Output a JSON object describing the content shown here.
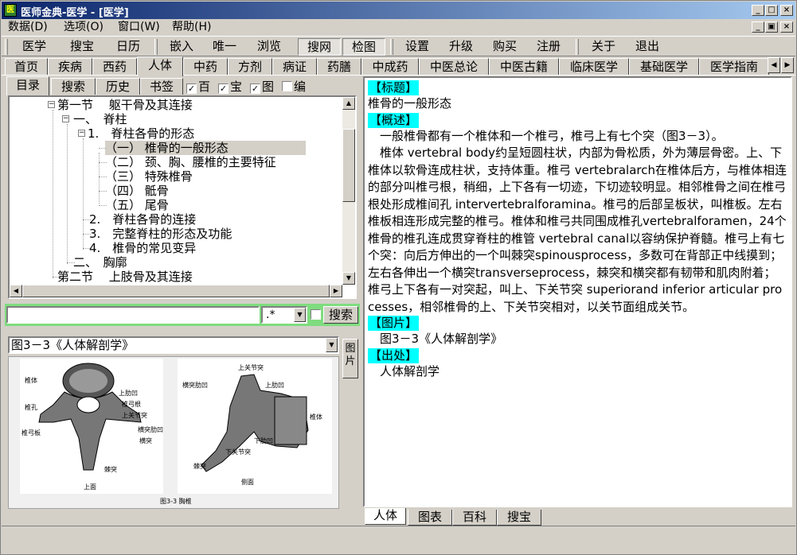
{
  "window": {
    "title": "医师金典-医学 - [医学]",
    "app_icon": "app-icon"
  },
  "menu": [
    "数据(D)",
    "选项(O)",
    "窗口(W)",
    "帮助(H)"
  ],
  "toolbar": {
    "group1": [
      "医学",
      "搜宝",
      "日历"
    ],
    "group2": [
      "嵌入",
      "唯一",
      "浏览"
    ],
    "group3": [
      "搜网",
      "检图"
    ],
    "group4": [
      "设置",
      "升级",
      "购买",
      "注册"
    ],
    "group5": [
      "关于",
      "退出"
    ]
  },
  "tabs": [
    "首页",
    "疾病",
    "西药",
    "人体",
    "中药",
    "方剂",
    "病证",
    "药膳",
    "中成药",
    "中医总论",
    "中医古籍",
    "临床医学",
    "基础医学",
    "医学指南"
  ],
  "active_tab": "人体",
  "left_tabs": [
    "目录",
    "搜索",
    "历史",
    "书签"
  ],
  "left_checks": [
    {
      "label": "百",
      "checked": true
    },
    {
      "label": "宝",
      "checked": true
    },
    {
      "label": "图",
      "checked": true
    },
    {
      "label": "编",
      "checked": false
    }
  ],
  "tree": [
    {
      "text": "第一节　 躯干骨及其连接",
      "level": 0,
      "expander": "minus"
    },
    {
      "text": "一、　脊柱",
      "level": 1,
      "expander": "minus"
    },
    {
      "text": "1.　脊柱各骨的形态",
      "level": 2,
      "expander": "minus"
    },
    {
      "text": "（一） 椎骨的一般形态",
      "level": 3,
      "selected": true
    },
    {
      "text": "（二） 颈、胸、腰椎的主要特征",
      "level": 3
    },
    {
      "text": "（三） 特殊椎骨",
      "level": 3
    },
    {
      "text": "（四） 骶骨",
      "level": 3
    },
    {
      "text": "（五） 尾骨",
      "level": 3
    },
    {
      "text": "2.　脊柱各骨的连接",
      "level": 2
    },
    {
      "text": "3.　完整脊柱的形态及功能",
      "level": 2
    },
    {
      "text": "4.　椎骨的常见变异",
      "level": 2
    },
    {
      "text": "二、　胸廓",
      "level": 1
    },
    {
      "text": "第二节　 上肢骨及其连接",
      "level": 0
    }
  ],
  "search": {
    "value": "",
    "mode": ".*",
    "button": "搜索"
  },
  "image_panel": {
    "selected": "图3－3《人体解剖学》",
    "side_tab": "图片",
    "figure_caption": "图3-3 胸椎",
    "view_top": "上面",
    "view_side": "侧面",
    "labels_top": [
      "椎体",
      "上肋凹",
      "椎孔",
      "椎弓根",
      "上关节突",
      "横突肋凹",
      "椎弓板",
      "横突",
      "棘突"
    ],
    "labels_side": [
      "上关节突",
      "上肋凹",
      "横突肋凹",
      "椎体",
      "下肋凹",
      "下关节突",
      "棘突"
    ]
  },
  "content": {
    "h_title": "【标题】",
    "title": "椎骨的一般形态",
    "h_summary": "【概述】",
    "summary_p1": "　一般椎骨都有一个椎体和一个椎弓，椎弓上有七个突（图3－3）。",
    "summary_p2": "　椎体 vertebral body约呈短圆柱状，内部为骨松质，外为薄层骨密。上、下椎体以软骨连成柱状，支持体重。椎弓 vertebralarch在椎体后方，与椎体相连的部分叫椎弓根，稍细，上下各有一切迹，下切迹较明显。相邻椎骨之间在椎弓根处形成椎间孔 intervertebralforamina。椎弓的后部呈板状，叫椎板。左右椎板相连形成完整的椎弓。椎体和椎弓共同围成椎孔vertebralforamen，24个椎骨的椎孔连成贯穿脊柱的椎管 vertebral canal以容纳保护脊髓。椎弓上有七个突：向后方伸出的一个叫棘突spinousprocess，多数可在背部正中线摸到；左右各伸出一个横突transverseprocess，棘突和横突都有韧带和肌肉附着；椎弓上下各有一对突起，叫上、下关节突 superiorand inferior articular processes，相邻椎骨的上、下关节突相对，以关节面组成关节。",
    "h_image": "【图片】",
    "image_ref": "　图3－3《人体解剖学》",
    "h_source": "【出处】",
    "source": "　人体解剖学"
  },
  "bottom_tabs": [
    "人体",
    "图表",
    "百科",
    "搜宝"
  ],
  "colors": {
    "title_start": "#0a246a",
    "title_end": "#a6caf0",
    "heading_bg": "#00ffff",
    "search_bar": "#7fdc7f",
    "face": "#d4d0c8"
  }
}
